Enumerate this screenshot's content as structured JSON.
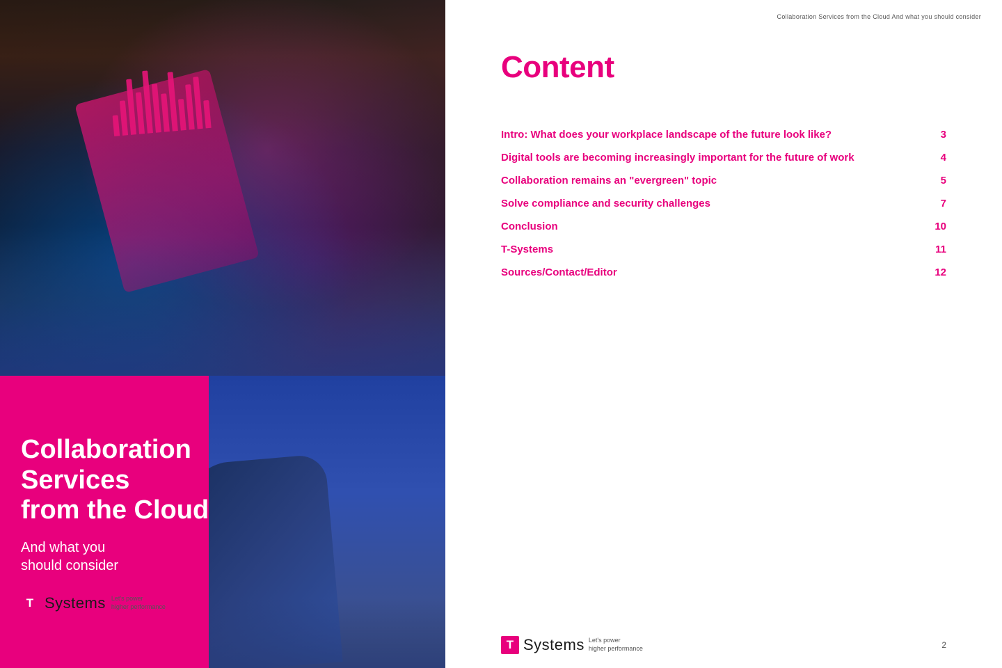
{
  "left": {
    "main_title": "Collaboration\nServices\nfrom the Cloud",
    "sub_title": "And what you\nshould consider",
    "logo": {
      "t_symbol": "T",
      "name": "Systems",
      "tagline_line1": "Let's power",
      "tagline_line2": "higher performance"
    },
    "data_bars": [
      30,
      50,
      80,
      60,
      90,
      70,
      55,
      85,
      45,
      65,
      75,
      40
    ]
  },
  "right": {
    "header_subtitle": "Collaboration Services from the Cloud And what you should consider",
    "content_heading": "Content",
    "toc": [
      {
        "entry": "Intro: What does your workplace landscape of the future look like?",
        "page": "3"
      },
      {
        "entry": "Digital tools are becoming increasingly important for the future of work",
        "page": "4"
      },
      {
        "entry": "Collaboration remains an \"evergreen\" topic",
        "page": "5"
      },
      {
        "entry": "Solve compliance and security challenges",
        "page": "7"
      },
      {
        "entry": "Conclusion",
        "page": "10"
      },
      {
        "entry": "T-Systems",
        "page": "11"
      },
      {
        "entry": "Sources/Contact/Editor",
        "page": "12"
      }
    ],
    "footer": {
      "logo_t": "T",
      "logo_name": "Systems",
      "tagline_line1": "Let's power",
      "tagline_line2": "higher performance",
      "page_number": "2"
    }
  }
}
